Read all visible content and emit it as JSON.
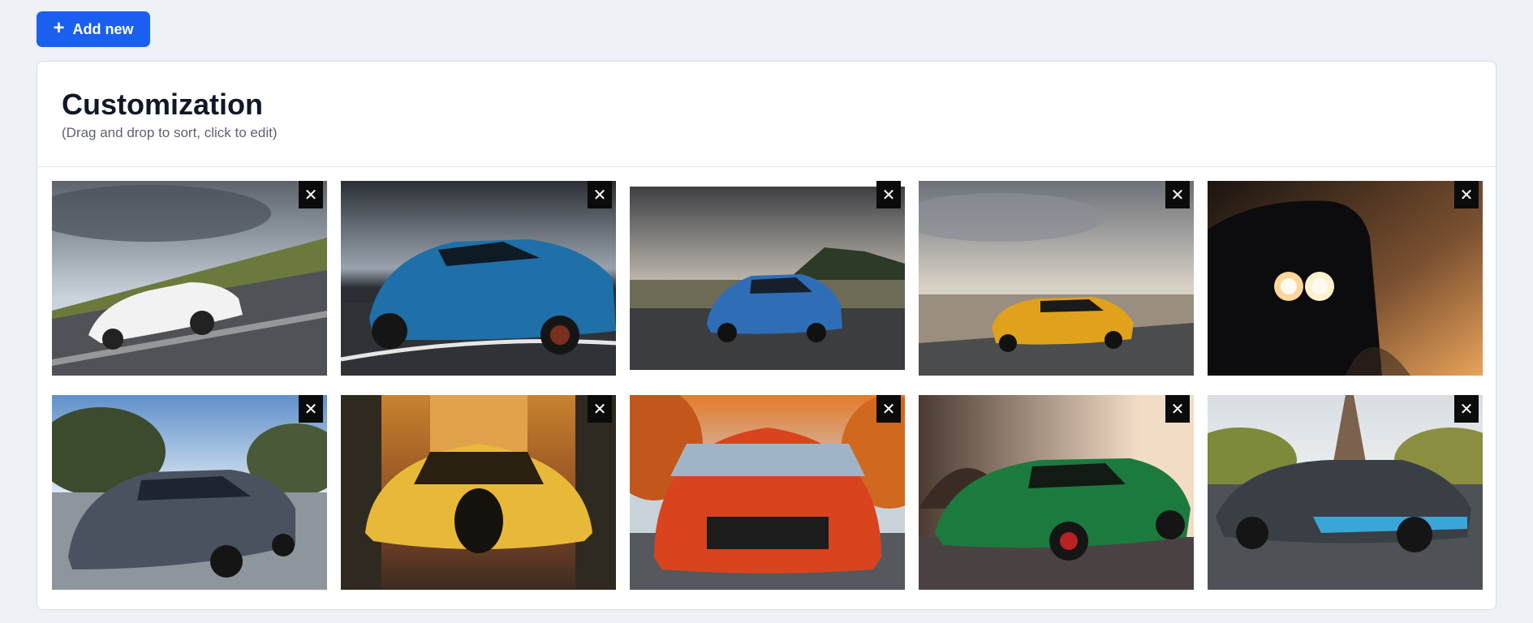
{
  "toolbar": {
    "add_label": "Add new",
    "add_icon": "plus-icon",
    "accent": "#1a5ff0"
  },
  "card": {
    "title": "Customization",
    "subtitle": "(Drag and drop to sort, click to edit)"
  },
  "gallery": {
    "remove_glyph": "✕",
    "items": [
      {
        "name": "white-porsche-photo"
      },
      {
        "name": "blue-bmw-concept-photo"
      },
      {
        "name": "blue-bmw-m4-photo"
      },
      {
        "name": "yellow-lamborghini-photo"
      },
      {
        "name": "black-muscle-car-photo"
      },
      {
        "name": "grey-mercedes-eqs-photo"
      },
      {
        "name": "yellow-bugatti-concept-photo"
      },
      {
        "name": "red-nissan-gtr-photo"
      },
      {
        "name": "green-supercar-photo"
      },
      {
        "name": "grey-bugatti-divo-photo"
      }
    ]
  }
}
